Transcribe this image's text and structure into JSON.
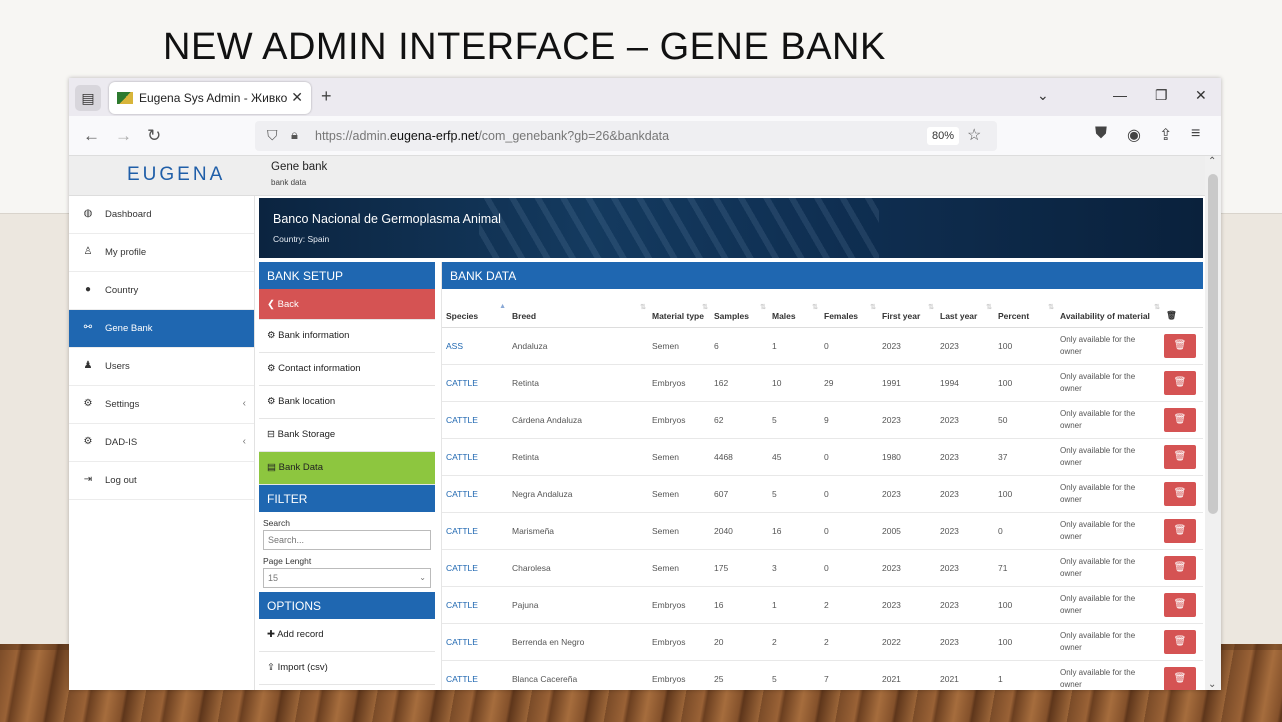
{
  "slide": {
    "title": "NEW ADMIN INTERFACE – GENE BANK"
  },
  "browser": {
    "tab_title": "Eugena Sys Admin - Живко Ду",
    "url_prefix": "https://admin.",
    "url_domain": "eugena-erfp.net",
    "url_path": "/com_genebank?gb=26&bankdata",
    "zoom": "80%"
  },
  "app": {
    "logo": "EUGENA",
    "breadcrumb_title": "Gene bank",
    "breadcrumb_sub": "bank data"
  },
  "sidebar": {
    "items": [
      {
        "label": "Dashboard",
        "icon": "dashboard-icon"
      },
      {
        "label": "My profile",
        "icon": "user-icon"
      },
      {
        "label": "Country",
        "icon": "globe-icon"
      },
      {
        "label": "Gene Bank",
        "icon": "dna-icon"
      },
      {
        "label": "Users",
        "icon": "users-icon"
      },
      {
        "label": "Settings",
        "icon": "cogs-icon"
      },
      {
        "label": "DAD-IS",
        "icon": "cogs-icon"
      },
      {
        "label": "Log out",
        "icon": "logout-icon"
      }
    ]
  },
  "banner": {
    "title": "Banco Nacional de Germoplasma Animal",
    "subtitle": "Country: Spain"
  },
  "setup": {
    "header": "BANK SETUP",
    "back": "Back",
    "items": [
      "Bank information",
      "Contact information",
      "Bank location",
      "Bank Storage",
      "Bank Data"
    ],
    "filter_header": "FILTER",
    "search_label": "Search",
    "search_placeholder": "Search...",
    "page_length_label": "Page Lenght",
    "page_length_value": "15",
    "options_header": "OPTIONS",
    "add_record": "Add record",
    "import_csv": "Import (csv)"
  },
  "bankdata": {
    "header": "BANK DATA",
    "columns": [
      "Species",
      "Breed",
      "Material type",
      "Samples",
      "Males",
      "Females",
      "First year",
      "Last year",
      "Percent",
      "Availability of material"
    ],
    "rows": [
      [
        "ASS",
        "Andaluza",
        "Semen",
        "6",
        "1",
        "0",
        "2023",
        "2023",
        "100",
        "Only available for the owner"
      ],
      [
        "CATTLE",
        "Retinta",
        "Embryos",
        "162",
        "10",
        "29",
        "1991",
        "1994",
        "100",
        "Only available for the owner"
      ],
      [
        "CATTLE",
        "Cárdena Andaluza",
        "Embryos",
        "62",
        "5",
        "9",
        "2023",
        "2023",
        "50",
        "Only available for the owner"
      ],
      [
        "CATTLE",
        "Retinta",
        "Semen",
        "4468",
        "45",
        "0",
        "1980",
        "2023",
        "37",
        "Only available for the owner"
      ],
      [
        "CATTLE",
        "Negra Andaluza",
        "Semen",
        "607",
        "5",
        "0",
        "2023",
        "2023",
        "100",
        "Only available for the owner"
      ],
      [
        "CATTLE",
        "Marismeña",
        "Semen",
        "2040",
        "16",
        "0",
        "2005",
        "2023",
        "0",
        "Only available for the owner"
      ],
      [
        "CATTLE",
        "Charolesa",
        "Semen",
        "175",
        "3",
        "0",
        "2023",
        "2023",
        "71",
        "Only available for the owner"
      ],
      [
        "CATTLE",
        "Pajuna",
        "Embryos",
        "16",
        "1",
        "2",
        "2023",
        "2023",
        "100",
        "Only available for the owner"
      ],
      [
        "CATTLE",
        "Berrenda en Negro",
        "Embryos",
        "20",
        "2",
        "2",
        "2022",
        "2023",
        "100",
        "Only available for the owner"
      ],
      [
        "CATTLE",
        "Blanca Cacereña",
        "Embryos",
        "25",
        "5",
        "7",
        "2021",
        "2021",
        "1",
        "Only available for the owner"
      ]
    ]
  },
  "colors": {
    "primary": "#1f67b1",
    "danger": "#d55353",
    "success": "#8dc63f"
  }
}
